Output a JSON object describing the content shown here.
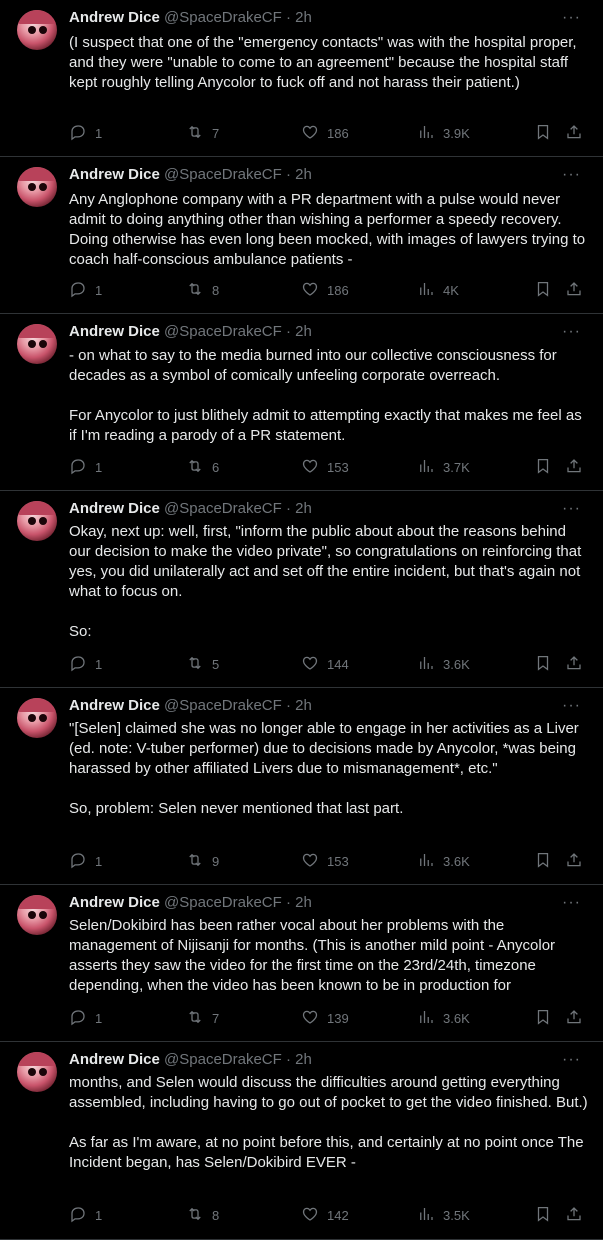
{
  "tweets": [
    {
      "name": "Andrew Dice",
      "handle": "@SpaceDrakeCF · 2h",
      "paragraphs": [
        "(I suspect that one of the \"emergency contacts\" was with the hospital proper, and they were \"unable to come to an agreement\" because the hospital staff kept roughly telling Anycolor to fuck off and not harass their patient.)"
      ],
      "replies": "1",
      "retweets": "7",
      "likes": "186",
      "views": "3.9K"
    },
    {
      "name": "Andrew Dice",
      "handle": "@SpaceDrakeCF · 2h",
      "paragraphs": [
        "Any Anglophone company with a PR department with a pulse would never admit to doing anything other than wishing a performer a speedy recovery. Doing otherwise has even long been mocked, with images of lawyers trying to coach half-conscious ambulance patients -"
      ],
      "replies": "1",
      "retweets": "8",
      "likes": "186",
      "views": "4K"
    },
    {
      "name": "Andrew Dice",
      "handle": "@SpaceDrakeCF · 2h",
      "paragraphs": [
        "- on what to say to the media burned into our collective consciousness for decades as a symbol of comically unfeeling corporate overreach.",
        "For Anycolor to just blithely admit to attempting exactly that makes me feel as if I'm reading a parody of a PR statement."
      ],
      "replies": "1",
      "retweets": "6",
      "likes": "153",
      "views": "3.7K"
    },
    {
      "name": "Andrew Dice",
      "handle": "@SpaceDrakeCF · 2h",
      "paragraphs": [
        "Okay, next up: well, first, \"inform the public about about the reasons behind our decision to make the video private\", so congratulations on reinforcing that yes, you did unilaterally act and set off the entire incident, but that's again not what to focus on.",
        "So:"
      ],
      "replies": "1",
      "retweets": "5",
      "likes": "144",
      "views": "3.6K"
    },
    {
      "name": "Andrew Dice",
      "handle": "@SpaceDrakeCF · 2h",
      "paragraphs": [
        "\"[Selen] claimed she was no longer able to engage in her activities as a Liver (ed. note: V-tuber performer) due to decisions made by Anycolor, *was being harassed by other affiliated Livers due to mismanagement*, etc.\"",
        "So, problem: Selen never mentioned that last part."
      ],
      "replies": "1",
      "retweets": "9",
      "likes": "153",
      "views": "3.6K"
    },
    {
      "name": "Andrew Dice",
      "handle": "@SpaceDrakeCF · 2h",
      "paragraphs": [
        "Selen/Dokibird has been rather vocal about her problems with the management of Nijisanji for months. (This is another mild point - Anycolor asserts they saw the video for the first time on the 23rd/24th, timezone depending, when the video has been known to be in production for"
      ],
      "replies": "1",
      "retweets": "7",
      "likes": "139",
      "views": "3.6K"
    },
    {
      "name": "Andrew Dice",
      "handle": "@SpaceDrakeCF · 2h",
      "paragraphs": [
        "months, and Selen would discuss the difficulties around getting everything assembled, including having to go out of pocket to get the video finished. But.)",
        "As far as I'm aware, at no point before this, and certainly at no point once The Incident began, has Selen/Dokibird EVER -"
      ],
      "replies": "1",
      "retweets": "8",
      "likes": "142",
      "views": "3.5K"
    }
  ]
}
